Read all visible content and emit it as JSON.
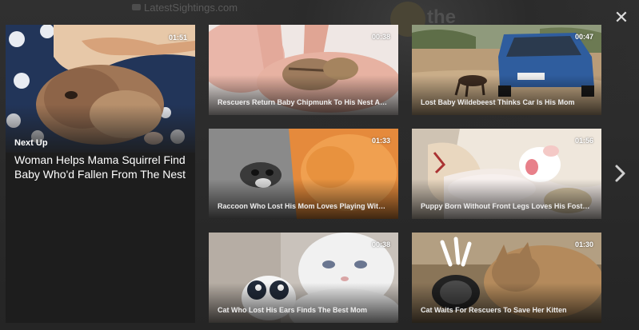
{
  "background": {
    "site_logo": "LatestSightings.com",
    "brand_fragment": "the"
  },
  "controls": {
    "close_icon": "close-icon",
    "next_icon": "chevron-right-icon"
  },
  "featured": {
    "duration": "01:51",
    "label": "Next Up",
    "title": "Woman Helps Mama Squirrel Find Baby Who'd Fallen From The Nest"
  },
  "videos": [
    {
      "duration": "00:38",
      "title": "Rescuers Return Baby Chipmunk To His Nest After Fall"
    },
    {
      "duration": "00:47",
      "title": "Lost Baby Wildebeest Thinks Car Is His Mom"
    },
    {
      "duration": "01:33",
      "title": "Raccoon Who Lost His Mom Loves Playing With His Cat"
    },
    {
      "duration": "01:56",
      "title": "Puppy Born Without Front Legs Loves His Foster Family"
    },
    {
      "duration": "00:38",
      "title": "Cat Who Lost His Ears Finds The Best Mom"
    },
    {
      "duration": "01:30",
      "title": "Cat Waits For Rescuers To Save Her Kitten"
    }
  ]
}
